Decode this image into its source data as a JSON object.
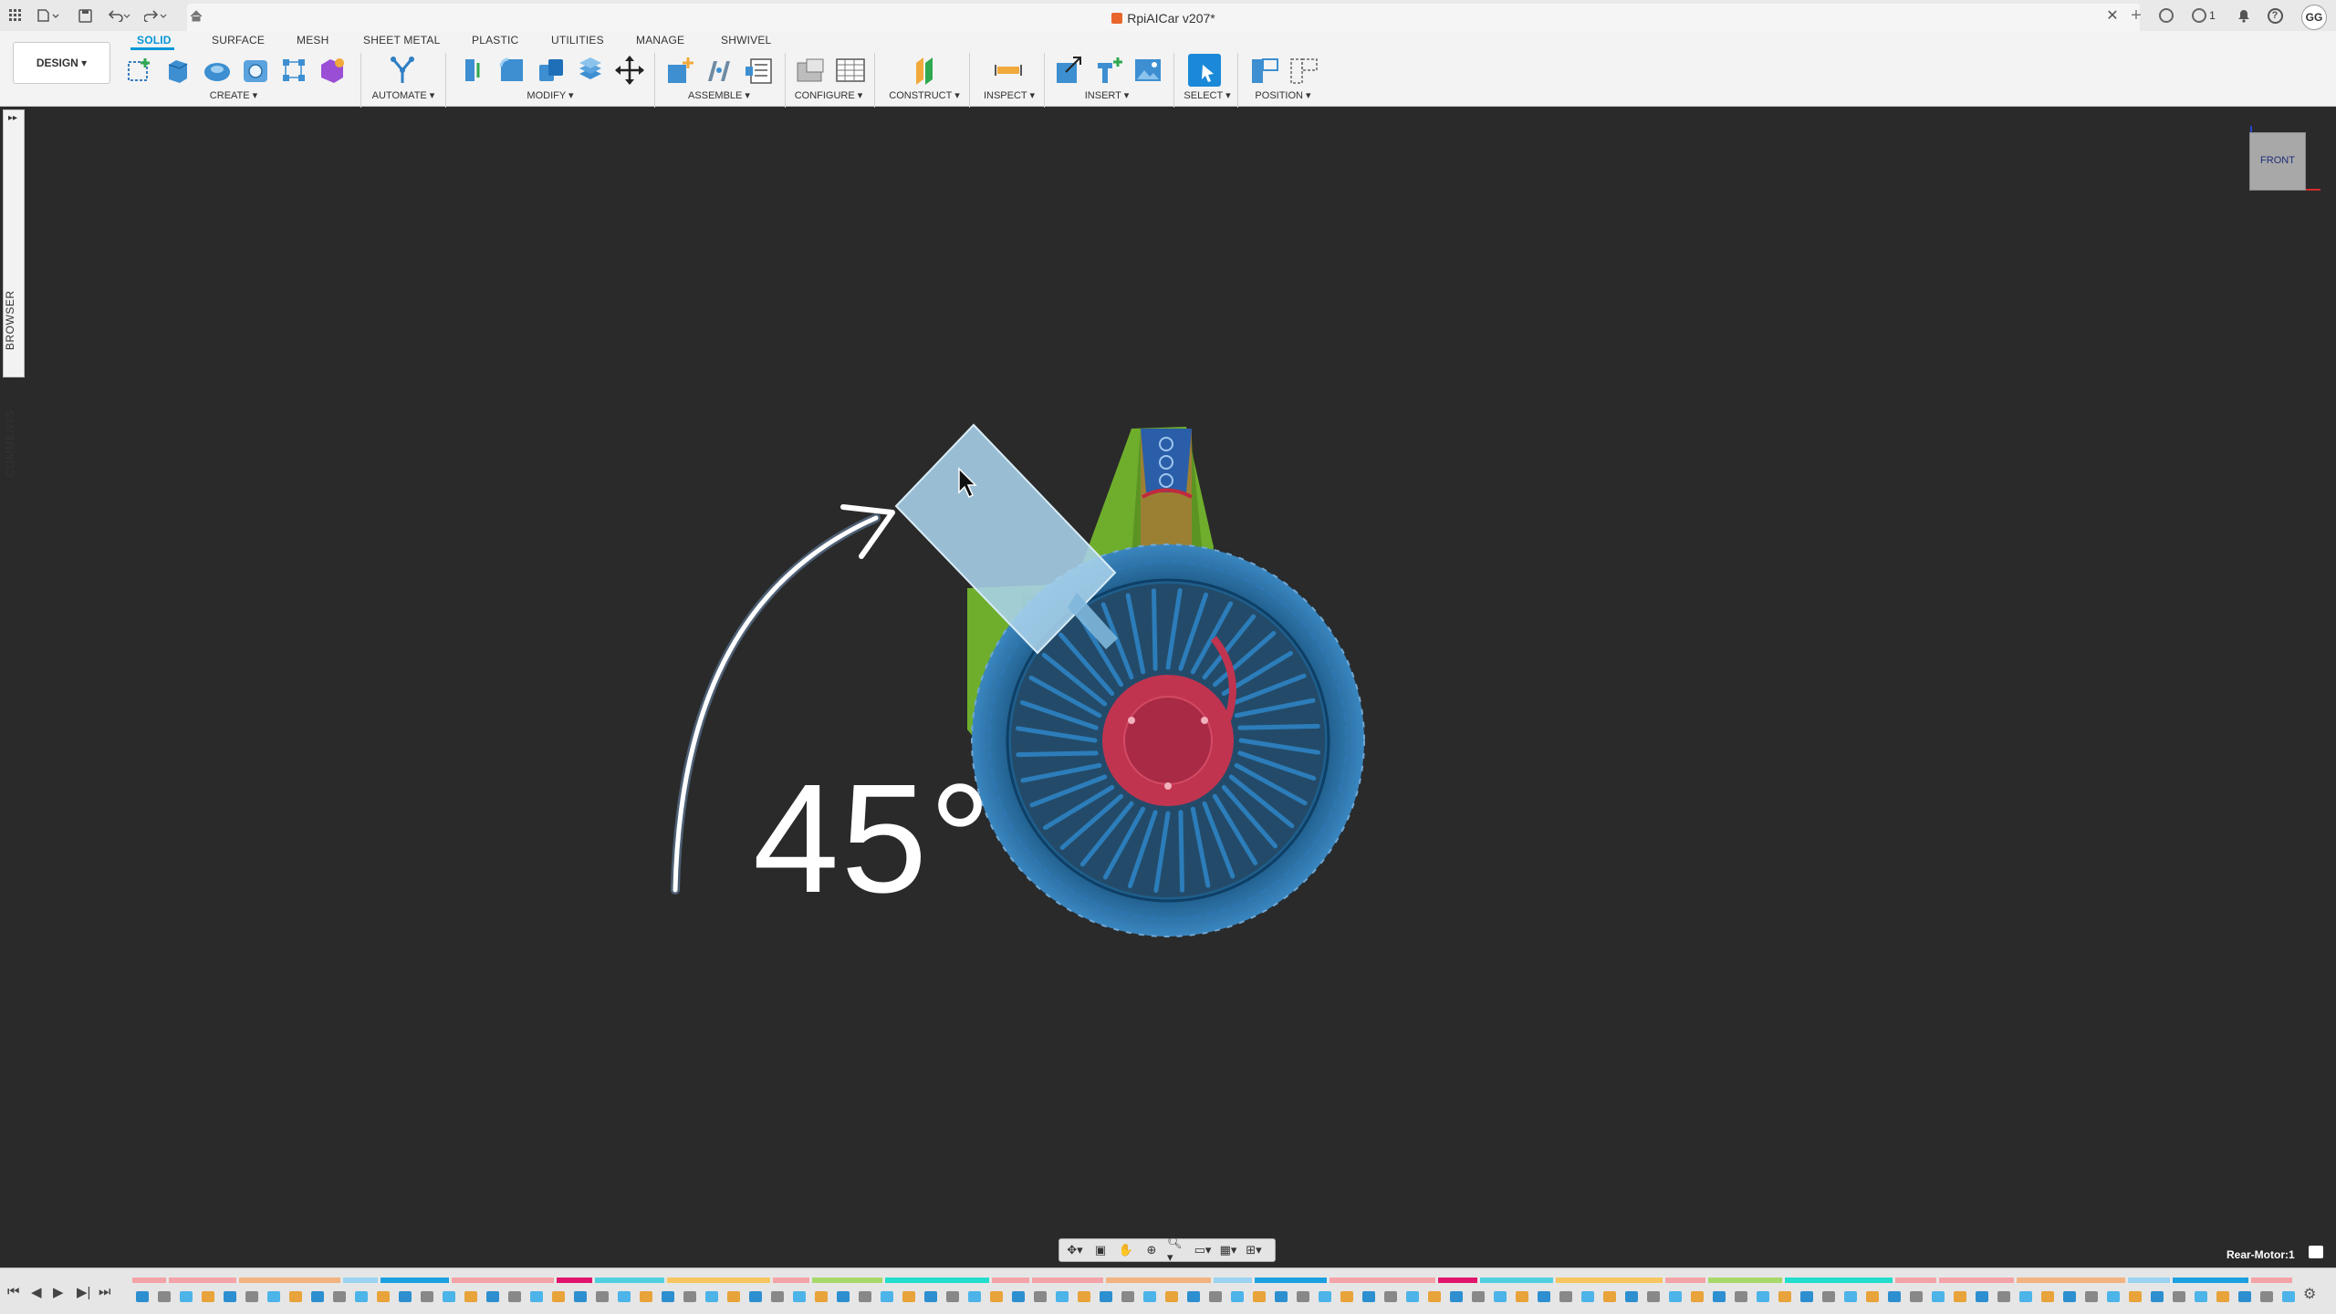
{
  "titlebar": {
    "document_title": "RpiAICar v207*",
    "job_count": "1",
    "user_initials": "GG",
    "icons": [
      "apps-grid-icon",
      "file-menu-icon",
      "save-icon",
      "undo-icon",
      "redo-icon",
      "home-icon",
      "close-tab-icon",
      "new-tab-icon",
      "extensions-icon",
      "job-status-icon",
      "notifications-icon",
      "help-icon"
    ]
  },
  "ribbon": {
    "workspace_button": "DESIGN ▾",
    "tabs": [
      "SOLID",
      "SURFACE",
      "MESH",
      "SHEET METAL",
      "PLASTIC",
      "UTILITIES",
      "MANAGE",
      "SHWIVEL"
    ],
    "active_tab": "SOLID",
    "groups": [
      "CREATE ▾",
      "AUTOMATE ▾",
      "MODIFY ▾",
      "ASSEMBLE ▾",
      "CONFIGURE ▾",
      "CONSTRUCT ▾",
      "INSPECT ▾",
      "INSERT ▾",
      "SELECT ▾",
      "POSITION ▾"
    ],
    "accent_color": "#0696d7"
  },
  "side_panels": {
    "browser": "BROWSER",
    "comments": "COMMENTS"
  },
  "viewcube": {
    "face": "FRONT"
  },
  "canvas": {
    "angle_annotation": "45°",
    "background_color": "#2a2a2a"
  },
  "status": {
    "selected_component": "Rear-Motor:1"
  },
  "navigation_tools": [
    "orbit-icon",
    "look-at-icon",
    "pan-icon",
    "zoom-window-icon",
    "zoom-icon",
    "display-settings-icon",
    "grid-icon",
    "viewports-icon"
  ],
  "timeline": {
    "controls": [
      "skip-to-start-icon",
      "step-back-icon",
      "play-icon",
      "step-forward-icon",
      "skip-to-end-icon"
    ]
  }
}
